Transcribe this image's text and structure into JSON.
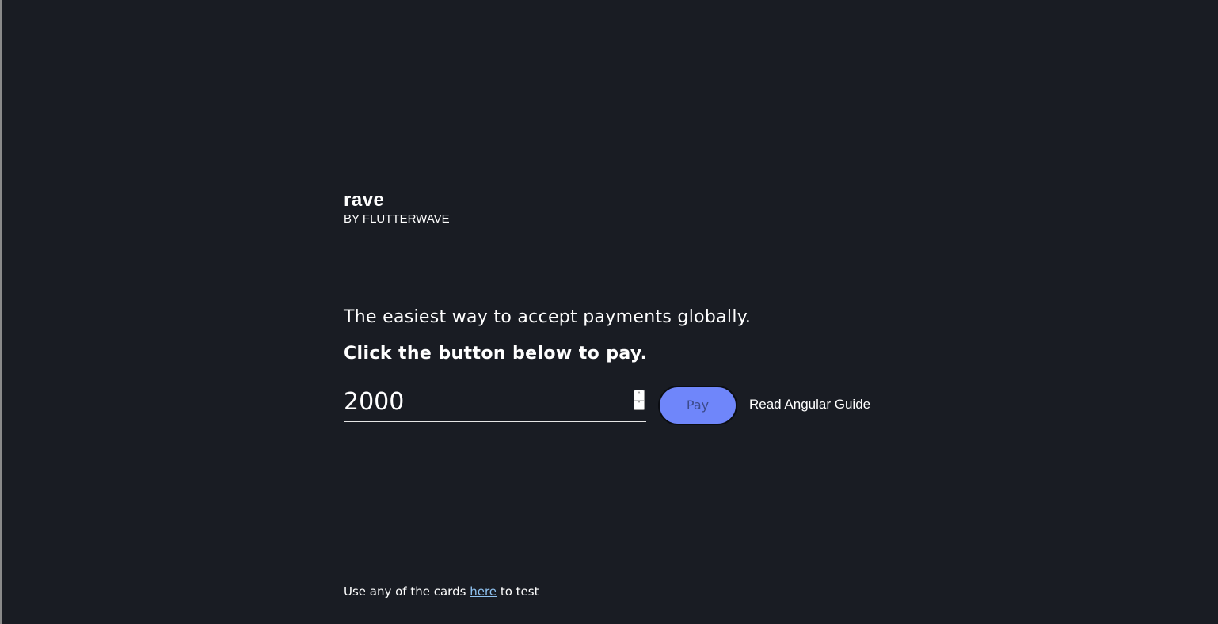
{
  "brand": {
    "logo_word": "rave",
    "logo_sub": "BY FLUTTERWAVE"
  },
  "hero": {
    "tagline": "The easiest way to accept payments globally.",
    "instruction": "Click the button below to pay."
  },
  "payment": {
    "amount_value": "2000",
    "spinner_up": "˄",
    "spinner_down": "˅",
    "pay_label": "Pay",
    "pay_color": "#6f86fa",
    "guide_label": "Read Angular Guide"
  },
  "footer": {
    "prefix": "Use any of the cards",
    "link_label": "here",
    "suffix": "to test"
  },
  "colors": {
    "background": "#191c23",
    "link": "#8fc2f0"
  }
}
